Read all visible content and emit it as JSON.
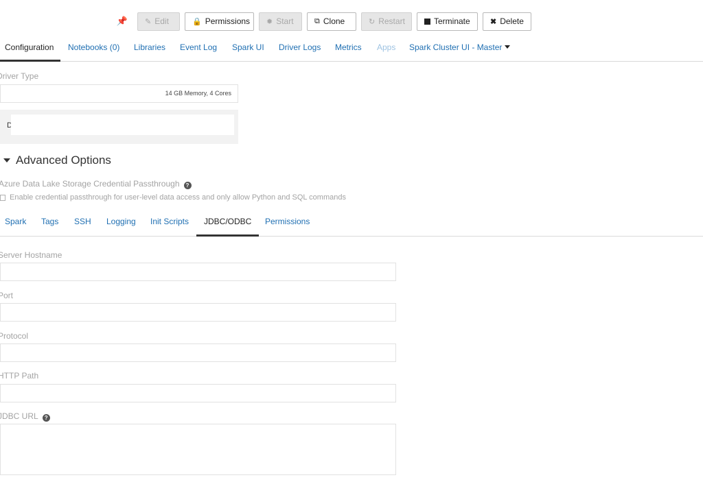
{
  "toolbar": {
    "edit": "Edit",
    "permissions": "Permissions",
    "start": "Start",
    "clone": "Clone",
    "restart": "Restart",
    "terminate": "Terminate",
    "delete": "Delete"
  },
  "tabs": [
    {
      "label": "Configuration",
      "active": true
    },
    {
      "label": "Notebooks (0)"
    },
    {
      "label": "Libraries"
    },
    {
      "label": "Event Log"
    },
    {
      "label": "Spark UI"
    },
    {
      "label": "Driver Logs"
    },
    {
      "label": "Metrics"
    },
    {
      "label": "Apps",
      "disabled": true
    },
    {
      "label": "Spark Cluster UI - Master"
    }
  ],
  "driver": {
    "label": "Driver Type",
    "value": "14 GB Memory, 4 Cores"
  },
  "panel": {
    "text": "D"
  },
  "advanced": {
    "title": "Advanced Options",
    "passthrough_label": "Azure Data Lake Storage Credential Passthrough",
    "passthrough_checkbox": "Enable credential passthrough for user-level data access and only allow Python and SQL commands"
  },
  "adv_tabs": [
    {
      "label": "Spark"
    },
    {
      "label": "Tags"
    },
    {
      "label": "SSH"
    },
    {
      "label": "Logging"
    },
    {
      "label": "Init Scripts"
    },
    {
      "label": "JDBC/ODBC",
      "active": true
    },
    {
      "label": "Permissions"
    }
  ],
  "jdbc": {
    "server_hostname": "Server Hostname",
    "port": "Port",
    "protocol": "Protocol",
    "http_path": "HTTP Path",
    "jdbc_url": "JDBC URL"
  },
  "icons": {
    "pin": "pin-icon",
    "edit": "edit-icon",
    "lock": "lock-icon",
    "spinner": "spinner-icon",
    "clone": "clone-icon",
    "refresh": "refresh-icon",
    "stop": "stop-icon",
    "close": "close-icon",
    "help": "help-icon"
  },
  "colors": {
    "link": "#1f6fb2",
    "pin": "#f5cf3f",
    "muted": "#a3a3a3"
  }
}
